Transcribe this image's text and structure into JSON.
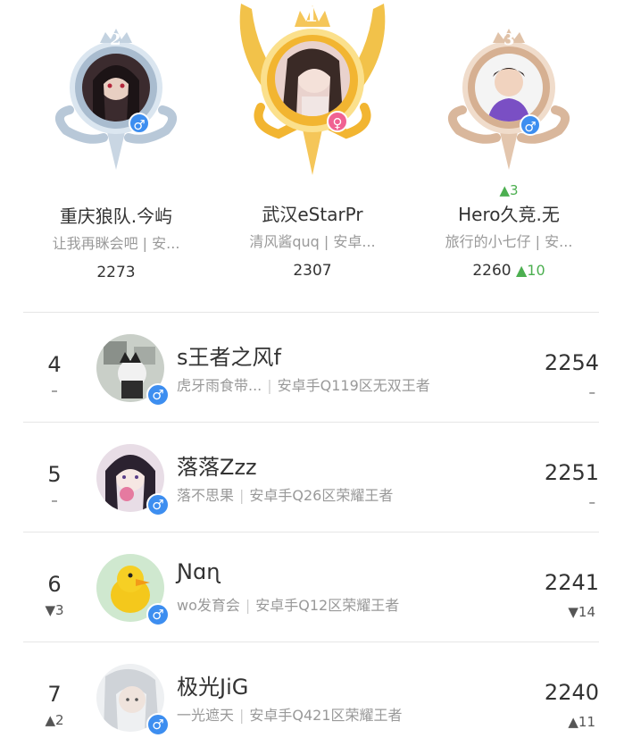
{
  "colors": {
    "up": "#4caf50",
    "down": "#e0544a",
    "male_badge": "#3d8ef0",
    "female_badge": "#f06292",
    "silver": "#aebfd0",
    "gold": "#f2b531",
    "bronze": "#d9b79c"
  },
  "podium": [
    {
      "rank": "2",
      "medal": "silver",
      "name": "重庆狼队.今屿",
      "sub": "让我再眯会吧 | 安...",
      "score": "2273",
      "change": "",
      "gender_icon": "♂",
      "rank_change_above": ""
    },
    {
      "rank": "1",
      "medal": "gold",
      "name": "武汉eStarPr",
      "sub": "清风酱quq | 安卓...",
      "score": "2307",
      "change": "",
      "gender_icon": "♀",
      "rank_change_above": ""
    },
    {
      "rank": "3",
      "medal": "bronze",
      "name": "Hero久竞.无",
      "sub": "旅行的小七仔 | 安...",
      "score": "2260",
      "change": "▲10",
      "gender_icon": "♂",
      "rank_change_above": "▲3"
    }
  ],
  "rows": [
    {
      "rank": "4",
      "rank_change": "–",
      "name": "s王者之风f",
      "sub_left": "虎牙雨食带...",
      "sub_right": "安卓手Q119区无双王者",
      "score": "2254",
      "score_change": "–",
      "gender_icon": "♂"
    },
    {
      "rank": "5",
      "rank_change": "–",
      "name": "落落Zzz",
      "sub_left": "落不思果",
      "sub_right": "安卓手Q26区荣耀王者",
      "score": "2251",
      "score_change": "–",
      "gender_icon": "♂"
    },
    {
      "rank": "6",
      "rank_change": "▼3",
      "name": "Ɲɑɳ",
      "sub_left": "wo发育会",
      "sub_right": "安卓手Q12区荣耀王者",
      "score": "2241",
      "score_change": "▼14",
      "gender_icon": "♂"
    },
    {
      "rank": "7",
      "rank_change": "▲2",
      "name": "极光JiG",
      "sub_left": "一光遮天",
      "sub_right": "安卓手Q421区荣耀王者",
      "score": "2240",
      "score_change": "▲11",
      "gender_icon": "♂"
    }
  ],
  "separator": "|"
}
